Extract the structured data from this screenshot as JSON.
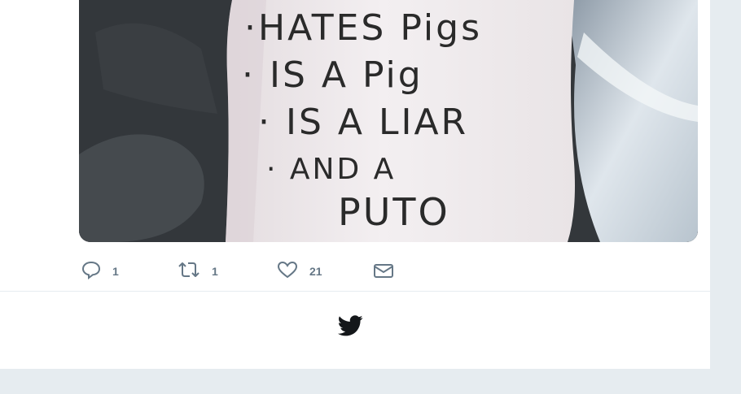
{
  "tweet": {
    "image": {
      "sign_text": [
        "·HATES Pigs",
        "· IS A Pig",
        "· IS A LIAR",
        "· AND A",
        "PUTO"
      ]
    },
    "actions": {
      "reply": {
        "icon": "reply-icon",
        "count": "1"
      },
      "retweet": {
        "icon": "retweet-icon",
        "count": "1"
      },
      "like": {
        "icon": "heart-icon",
        "count": "21"
      },
      "message": {
        "icon": "envelope-icon"
      }
    }
  },
  "footer": {
    "logo": "twitter-bird-icon"
  },
  "colors": {
    "page_background": "#e6ecf0",
    "card_background": "#ffffff",
    "icon_gray": "#657786",
    "logo": "#14171a"
  }
}
